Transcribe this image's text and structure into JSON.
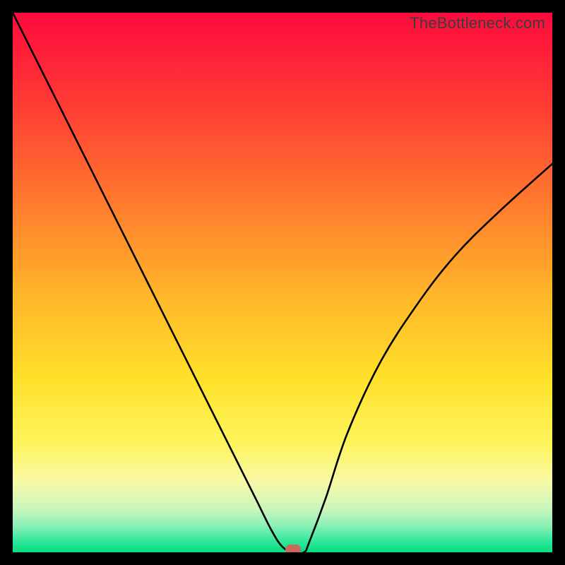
{
  "watermark": "TheBottleneck.com",
  "chart_data": {
    "type": "line",
    "title": "",
    "xlabel": "",
    "ylabel": "",
    "xlim": [
      0,
      100
    ],
    "ylim": [
      0,
      100
    ],
    "grid": false,
    "series": [
      {
        "name": "bottleneck-curve",
        "x": [
          0,
          5,
          10,
          15,
          20,
          25,
          30,
          35,
          40,
          45,
          48,
          50,
          52,
          54,
          55,
          58,
          62,
          68,
          75,
          82,
          90,
          100
        ],
        "values": [
          100,
          90,
          80,
          70,
          60,
          50,
          40,
          30,
          20,
          10,
          4,
          1,
          0,
          0,
          2,
          10,
          22,
          35,
          46,
          55,
          63,
          72
        ]
      }
    ],
    "marker": {
      "x": 52,
      "y": 0,
      "color": "#c96a5c"
    },
    "gradient_stops": [
      {
        "pos": 0,
        "color": "#ff0a3c"
      },
      {
        "pos": 18,
        "color": "#ff3e34"
      },
      {
        "pos": 35,
        "color": "#ff7a2e"
      },
      {
        "pos": 52,
        "color": "#ffb52a"
      },
      {
        "pos": 68,
        "color": "#ffe12a"
      },
      {
        "pos": 80,
        "color": "#fdf55e"
      },
      {
        "pos": 87,
        "color": "#f8f9a8"
      },
      {
        "pos": 92,
        "color": "#c9f6bc"
      },
      {
        "pos": 95,
        "color": "#8cf0b7"
      },
      {
        "pos": 98,
        "color": "#2ee89a"
      },
      {
        "pos": 100,
        "color": "#06dd7f"
      }
    ]
  }
}
